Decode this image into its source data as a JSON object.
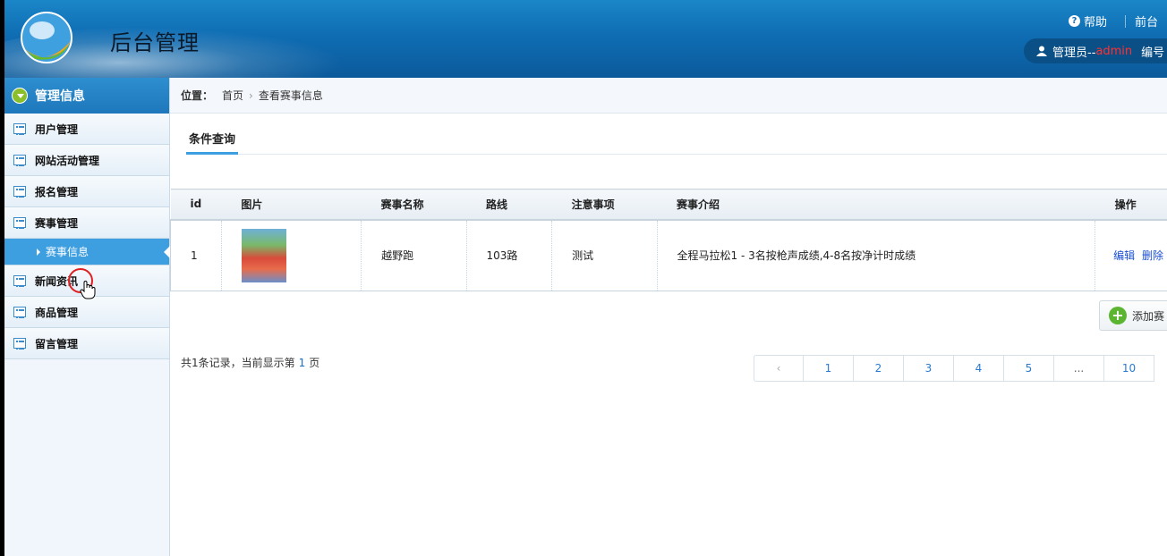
{
  "header": {
    "title": "后台管理",
    "help": "帮助",
    "frontend": "前台",
    "user_prefix": "管理员--",
    "user_name": "admin",
    "user_suffix": "编号"
  },
  "sidebar": {
    "section": "管理信息",
    "items": [
      {
        "label": "用户管理"
      },
      {
        "label": "网站活动管理"
      },
      {
        "label": "报名管理"
      },
      {
        "label": "赛事管理"
      },
      {
        "label": "赛事信息"
      },
      {
        "label": "新闻资讯"
      },
      {
        "label": "商品管理"
      },
      {
        "label": "留言管理"
      }
    ]
  },
  "breadcrumb": {
    "label": "位置：",
    "home": "首页",
    "current": "查看赛事信息"
  },
  "tab": "条件查询",
  "table": {
    "headers": [
      "id",
      "图片",
      "赛事名称",
      "路线",
      "注意事项",
      "赛事介绍",
      "操作"
    ],
    "rows": [
      {
        "id": "1",
        "name": "越野跑",
        "route": "103路",
        "notes": "测试",
        "intro": "全程马拉松1 - 3名按枪声成绩,4-8名按净计时成绩",
        "edit": "编辑",
        "delete": "删除"
      }
    ]
  },
  "add_button": "添加赛",
  "summary": {
    "prefix": "共1条记录，当前显示第",
    "page": "1",
    "suffix": "页"
  },
  "pagination": [
    "‹",
    "1",
    "2",
    "3",
    "4",
    "5",
    "...",
    "10"
  ],
  "colors": {
    "header_blue": "#0f6db3",
    "sidebar_active": "#3d9ee0",
    "link_blue": "#1a4fd6",
    "admin_red": "#ff3030"
  }
}
